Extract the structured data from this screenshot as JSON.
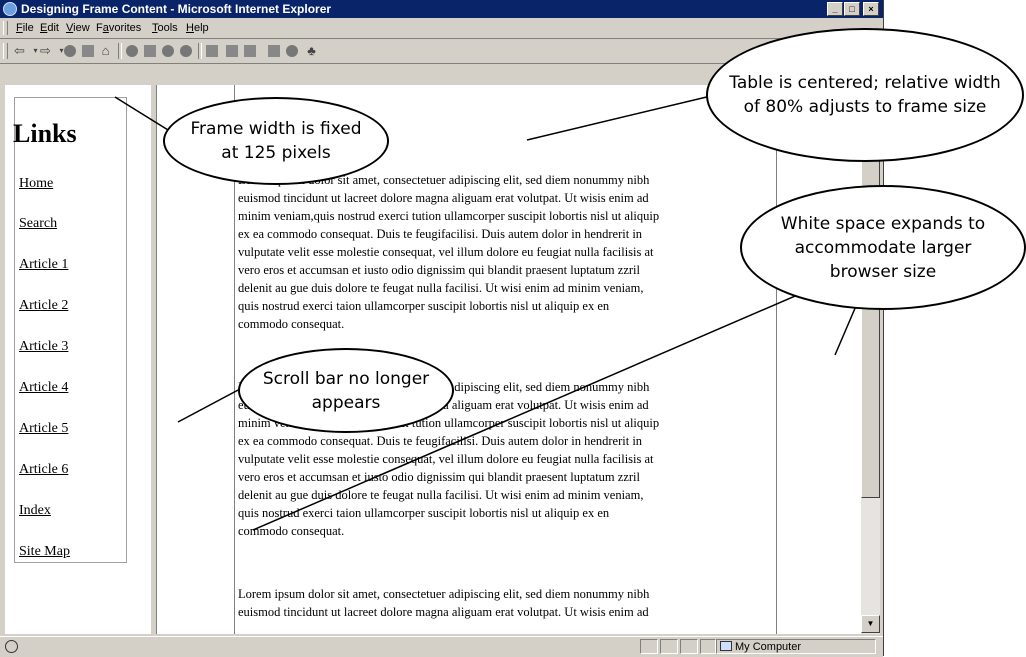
{
  "window": {
    "title": "Designing Frame Content - Microsoft Internet Explorer",
    "minimize_glyph": "_",
    "maximize_glyph": "□",
    "close_glyph": "×"
  },
  "menu": [
    {
      "accel": "F",
      "rest": "ile"
    },
    {
      "accel": "E",
      "rest": "dit"
    },
    {
      "accel": "V",
      "rest": "iew"
    },
    {
      "pre": "F",
      "accel": "a",
      "rest": "vorites"
    },
    {
      "accel": "T",
      "rest": "ools"
    },
    {
      "accel": "H",
      "rest": "elp"
    }
  ],
  "toolbar": {
    "back_glyph": "⇦",
    "forward_glyph": "⇨",
    "icons": [
      "back-icon",
      "forward-icon",
      "stop-icon",
      "refresh-icon",
      "home-icon",
      "search-icon",
      "favorites-icon",
      "history-icon",
      "media-icon",
      "mail-icon",
      "print-icon",
      "edit-icon",
      "discuss-icon",
      "messenger-icon"
    ]
  },
  "links_frame": {
    "title": "Links",
    "items": [
      "Home",
      "Search",
      "Article 1",
      "Article 2",
      "Article 3",
      "Article 4",
      "Article 5",
      "Article 6",
      "Index",
      "Site Map"
    ]
  },
  "article": {
    "para1_lines": [
      "Lorem ipsum dolor sit amet, consectetuer adipiscing elit, sed diem nonummy nibh",
      "euismod tincidunt ut lacreet dolore magna aliguam erat volutpat. Ut wisis enim ad",
      "minim veniam,quis nostrud exerci tution ullamcorper suscipit lobortis nisl ut aliquip",
      "ex ea commodo consequat. Duis te feugifacilisi. Duis autem dolor in hendrerit in",
      "vulputate velit esse molestie consequat, vel illum dolore eu feugiat nulla facilisis at",
      "vero eros et accumsan et iusto odio dignissim qui blandit praesent luptatum zzril",
      "delenit au gue duis dolore te feugat nulla facilisi. Ut wisi enim ad minim veniam,",
      "quis nostrud exerci taion ullamcorper suscipit lobortis nisl ut aliquip ex en",
      "commodo consequat."
    ],
    "para2_lines": [
      "Lorem ipsum dolor sit amet, consectetuer adipiscing elit, sed diem nonummy nibh",
      "euismod tincidunt ut lacreet dolore magna aliguam erat volutpat. Ut wisis enim ad",
      "minim veniam,quis nostrud exerci tution ullamcorper suscipit lobortis nisl ut aliquip",
      "ex ea commodo consequat. Duis te feugifacilisi. Duis autem dolor in hendrerit in",
      "vulputate velit esse molestie consequat, vel illum dolore eu feugiat nulla facilisis at",
      "vero eros et accumsan et iusto odio dignissim qui blandit praesent luptatum zzril",
      "delenit au gue duis dolore te feugat nulla facilisi. Ut wisi enim ad minim veniam,",
      "quis nostrud exerci taion ullamcorper suscipit lobortis nisl ut aliquip ex en",
      "commodo consequat."
    ],
    "para3_lines": [
      "Lorem ipsum dolor sit amet, consectetuer adipiscing elit, sed diem nonummy nibh",
      "euismod tincidunt ut lacreet dolore magna aliguam erat volutpat. Ut wisis enim ad"
    ]
  },
  "scrollbar": {
    "up_glyph": "▲",
    "down_glyph": "▼"
  },
  "statusbar": {
    "zone": "My Computer"
  },
  "callouts": {
    "frame_width": "Frame width is fixed at 125 pixels",
    "table_centered": "Table is centered; relative width of 80% adjusts to frame size",
    "white_space": "White space expands to accommodate larger browser size",
    "scroll_bar": "Scroll bar no longer appears"
  }
}
